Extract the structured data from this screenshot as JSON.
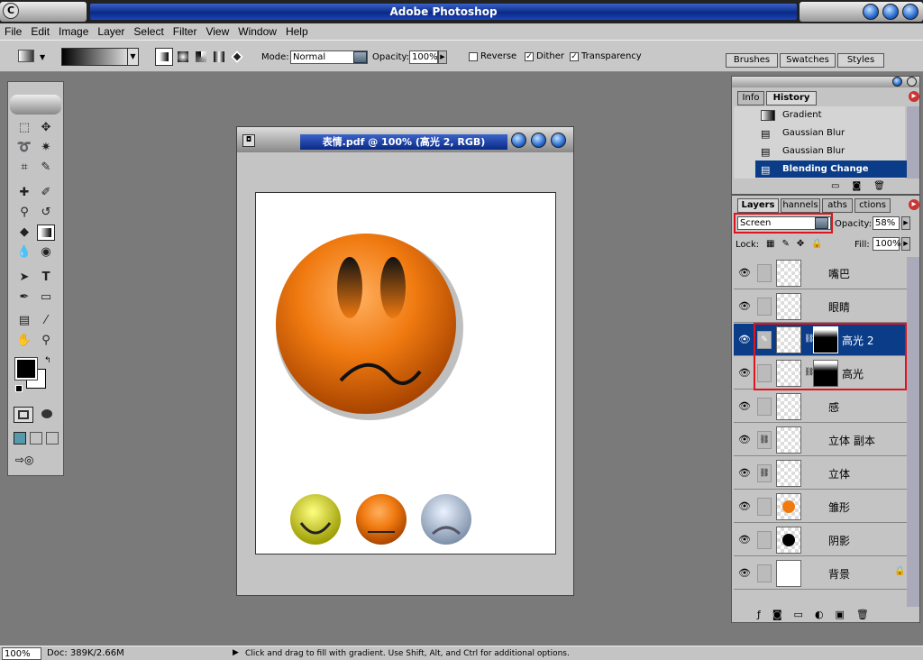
{
  "window": {
    "title": "Adobe Photoshop"
  },
  "menu": [
    "File",
    "Edit",
    "Image",
    "Layer",
    "Select",
    "Filter",
    "View",
    "Window",
    "Help"
  ],
  "options": {
    "mode_label": "Mode:",
    "mode_value": "Normal",
    "opacity_label": "Opacity:",
    "opacity_value": "100%",
    "reverse_label": "Reverse",
    "dither_label": "Dither",
    "transparency_label": "Transparency"
  },
  "palette_well": [
    "Brushes",
    "Swatches",
    "Styles"
  ],
  "document": {
    "title": "表情.pdf @ 100% (高光 2, RGB)"
  },
  "history": {
    "tabs": [
      "Info",
      "History"
    ],
    "items": [
      "Gradient",
      "Gaussian Blur",
      "Gaussian Blur",
      "Blending Change"
    ]
  },
  "layers": {
    "tabs": [
      "Layers",
      "Channels",
      "Paths",
      "Actions"
    ],
    "tabs_shown": [
      "Layers",
      "hannels",
      "aths",
      "ctions"
    ],
    "blend_mode": "Screen",
    "opacity_label": "Opacity:",
    "opacity_value": "58%",
    "lock_label": "Lock:",
    "fill_label": "Fill:",
    "fill_value": "100%",
    "items": [
      "嘴巴",
      "眼睛",
      "高光 2",
      "高光",
      "感",
      "立体 副本",
      "立体",
      "雏形",
      "阴影",
      "背景"
    ]
  },
  "status": {
    "zoom": "100%",
    "doc": "Doc: 389K/2.66M",
    "hint": "Click and drag to fill with gradient.  Use Shift, Alt, and Ctrl for additional options."
  },
  "colors": {
    "accent": "#0a3c88",
    "highlight_box": "#e0141e",
    "face": "#f07a10"
  }
}
